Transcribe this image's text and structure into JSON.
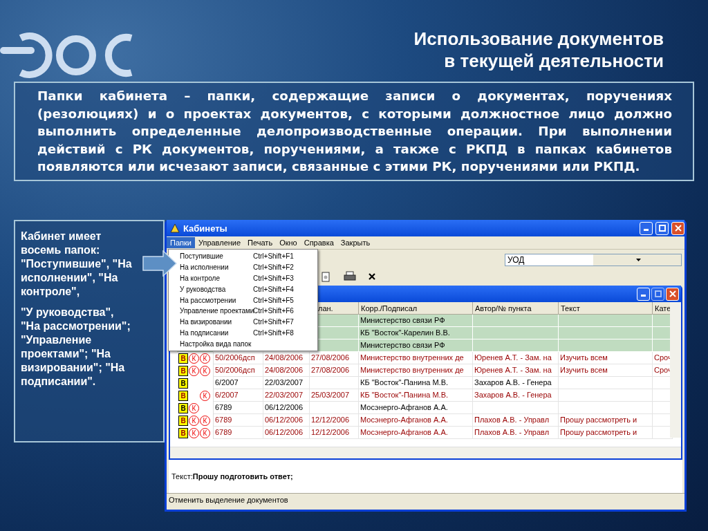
{
  "slide": {
    "title": [
      "Использование документов",
      "в текущей деятельности"
    ],
    "paragraph": "Папки кабинета – папки, содержащие записи о документах, поручениях (резолюциях) и о проектах документов, с которыми должностное лицо должно выполнить определенные делопроизводственные операции. При выполнении действий с РК документов, поручениями, а также с РКПД в папках кабинетов появляются или исчезают записи, связанные с этими РК, поручениями или РКПД.",
    "callout": [
      "Кабинет имеет восемь папок: \"Поступившие\", \"На исполнении\", \"На контроле\",",
      "\"У руководства\", \"На рассмотрении\"; \"Управление проектами\"; \"На визировании\"; \"На подписании\"."
    ]
  },
  "window": {
    "title": "Кабинеты",
    "menu": [
      {
        "label": "Папки",
        "selected": true
      },
      {
        "label": "Управление",
        "selected": false
      },
      {
        "label": "Печать",
        "selected": false
      },
      {
        "label": "Окно",
        "selected": false
      },
      {
        "label": "Справка",
        "selected": false
      },
      {
        "label": "Закрыть",
        "selected": false
      }
    ],
    "dropdown": [
      {
        "label": "Поступившие",
        "shortcut": "Ctrl+Shift+F1"
      },
      {
        "label": "На исполнении",
        "shortcut": "Ctrl+Shift+F2"
      },
      {
        "label": "На контроле",
        "shortcut": "Ctrl+Shift+F3"
      },
      {
        "label": "У руководства",
        "shortcut": "Ctrl+Shift+F4"
      },
      {
        "label": "На рассмотрении",
        "shortcut": "Ctrl+Shift+F5"
      },
      {
        "label": "Управление проектами",
        "shortcut": "Ctrl+Shift+F6"
      },
      {
        "label": "На визировании",
        "shortcut": "Ctrl+Shift+F7"
      },
      {
        "label": "На подписании",
        "shortcut": "Ctrl+Shift+F8"
      },
      {
        "label": "Настройка вида папок"
      }
    ],
    "combo": {
      "value": "УОД"
    },
    "table": {
      "columns": [
        null,
        null,
        "лан.",
        "Корр./Подписал",
        "Автор/№ пункта",
        "Текст",
        "Кате"
      ],
      "rows": [
        {
          "selected": true,
          "color": "#000000",
          "marks": [],
          "cells": [
            null,
            null,
            null,
            "Министерство связи РФ",
            null,
            null,
            null
          ]
        },
        {
          "selected": true,
          "color": "#000000",
          "marks": [],
          "cells": [
            null,
            null,
            null,
            "КБ \"Восток\"-Карелин В.В.",
            null,
            null,
            null
          ]
        },
        {
          "selected": true,
          "color": "#000000",
          "marks": [],
          "cells": [
            null,
            null,
            null,
            "Министерство связи РФ",
            null,
            null,
            null
          ]
        },
        {
          "selected": false,
          "color": "#990000",
          "marks": [
            {
              "kind": "square",
              "label": "В"
            },
            {
              "kind": "circle",
              "label": "К"
            },
            {
              "kind": "circle",
              "label": "К"
            }
          ],
          "cells": [
            "50/2006дсп",
            "24/08/2006",
            "27/08/2006",
            "Министерство внутренних де",
            "Юренев А.Т. - Зам. на",
            "Изучить всем",
            "Сроч"
          ]
        },
        {
          "selected": false,
          "color": "#990000",
          "marks": [
            {
              "kind": "square",
              "label": "В"
            },
            {
              "kind": "circle",
              "label": "К"
            },
            {
              "kind": "circle",
              "label": "К"
            }
          ],
          "cells": [
            "50/2006дсп",
            "24/08/2006",
            "27/08/2006",
            "Министерство внутренних де",
            "Юренев А.Т. - Зам. на",
            "Изучить всем",
            "Сроч"
          ]
        },
        {
          "selected": false,
          "color": "#000000",
          "marks": [
            {
              "kind": "square",
              "label": "В"
            }
          ],
          "cells": [
            "6/2007",
            "22/03/2007",
            null,
            "КБ \"Восток\"-Панина М.В.",
            "Захаров А.В. - Генера",
            null,
            null
          ]
        },
        {
          "selected": false,
          "color": "#990000",
          "marks": [
            {
              "kind": "square",
              "label": "В"
            },
            {
              "kind": "none"
            },
            {
              "kind": "circle",
              "label": "К"
            }
          ],
          "cells": [
            "6/2007",
            "22/03/2007",
            "25/03/2007",
            "КБ \"Восток\"-Панина М.В.",
            "Захаров А.В. - Генера",
            null,
            null
          ]
        },
        {
          "selected": false,
          "color": "#000000",
          "marks": [
            {
              "kind": "square",
              "label": "В"
            },
            {
              "kind": "circle",
              "label": "К"
            }
          ],
          "cells": [
            "6789",
            "06/12/2006",
            null,
            "Мосэнерго-Афганов А.А.",
            null,
            null,
            null
          ]
        },
        {
          "selected": false,
          "color": "#990000",
          "marks": [
            {
              "kind": "square",
              "label": "В"
            },
            {
              "kind": "circle",
              "label": "К"
            },
            {
              "kind": "circle",
              "label": "К"
            }
          ],
          "cells": [
            "6789",
            "06/12/2006",
            "12/12/2006",
            "Мосэнерго-Афганов А.А.",
            "Плахов А.В. - Управл",
            "Прошу рассмотреть и",
            null
          ]
        },
        {
          "selected": false,
          "color": "#990000",
          "marks": [
            {
              "kind": "square",
              "label": "В"
            },
            {
              "kind": "circle",
              "label": "К"
            },
            {
              "kind": "circle",
              "label": "К"
            }
          ],
          "cells": [
            "6789",
            "06/12/2006",
            "12/12/2006",
            "Мосэнерго-Афганов А.А.",
            "Плахов А.В. - Управл",
            "Прошу рассмотреть и",
            null
          ]
        }
      ]
    },
    "detail": "Текст:**Прошу подготовить ответ;**",
    "status_bar": "Отменить выделение документов"
  }
}
